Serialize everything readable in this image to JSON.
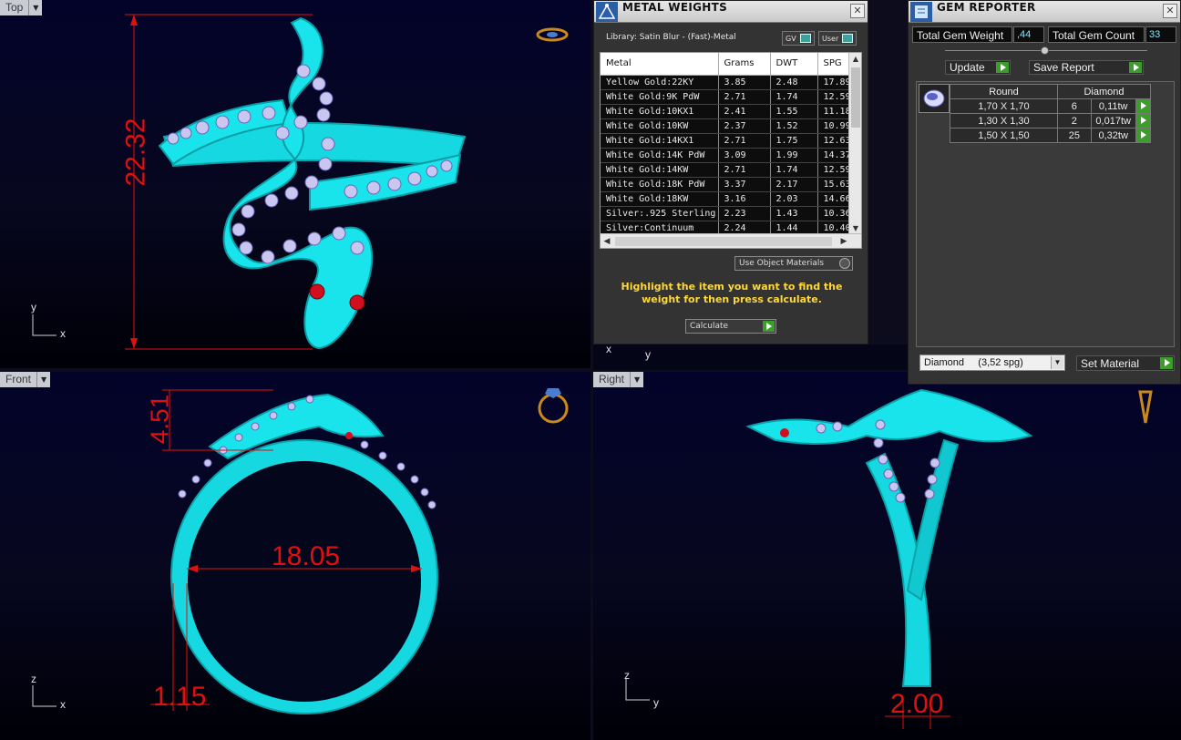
{
  "viewports": {
    "top": {
      "label": "Top",
      "dimension": "22.32",
      "axis_y": "y",
      "axis_x": "x"
    },
    "front": {
      "label": "Front",
      "dimension_height": "4.51",
      "dimension_width": "18.05",
      "dimension_thickness": "1.15",
      "axis_z": "z",
      "axis_x": "x"
    },
    "right": {
      "label": "Right",
      "dimension": "2.00",
      "axis_z": "z",
      "axis_y": "y"
    },
    "perspective_axes": {
      "x": "x",
      "y": "y"
    }
  },
  "metal_weights": {
    "title": "METAL WEIGHTS",
    "library": "Library: Satin Blur - (Fast)-Metal",
    "toggle_gv": "GV",
    "toggle_user": "User",
    "columns": [
      "Metal",
      "Grams",
      "DWT",
      "SPG"
    ],
    "rows": [
      [
        "Yellow Gold:22KY",
        "3.85",
        "2.48",
        "17.89"
      ],
      [
        "White Gold:9K PdW",
        "2.71",
        "1.74",
        "12.59"
      ],
      [
        "White Gold:10KX1",
        "2.41",
        "1.55",
        "11.18"
      ],
      [
        "White Gold:10KW",
        "2.37",
        "1.52",
        "10.99"
      ],
      [
        "White Gold:14KX1",
        "2.71",
        "1.75",
        "12.63"
      ],
      [
        "White Gold:14K PdW",
        "3.09",
        "1.99",
        "14.37"
      ],
      [
        "White Gold:14KW",
        "2.71",
        "1.74",
        "12.59"
      ],
      [
        "White Gold:18K PdW",
        "3.37",
        "2.17",
        "15.63"
      ],
      [
        "White Gold:18KW",
        "3.16",
        "2.03",
        "14.66"
      ],
      [
        "Silver:.925 Sterling",
        "2.23",
        "1.43",
        "10.36"
      ],
      [
        "Silver:Continuum",
        "2.24",
        "1.44",
        "10.40"
      ]
    ],
    "use_object_materials": "Use Object Materials",
    "hint": "Highlight the item you want to find the weight for then press calculate.",
    "calculate": "Calculate"
  },
  "gem_reporter": {
    "title": "GEM REPORTER",
    "total_gem_weight_label": "Total Gem Weight",
    "total_gem_weight_value": ",44",
    "total_gem_count_label": "Total Gem Count",
    "total_gem_count_value": "33",
    "update": "Update",
    "save_report": "Save Report",
    "columns": [
      "Round",
      "Diamond"
    ],
    "rows": [
      [
        "1,70 X 1,70",
        "6",
        "0,11tw"
      ],
      [
        "1,30 X 1,30",
        "2",
        "0,017tw"
      ],
      [
        "1,50 X 1,50",
        "25",
        "0,32tw"
      ]
    ],
    "material_select": "Diamond     (3,52 spg)",
    "set_material": "Set Material"
  },
  "colors": {
    "ring": "#16e0e8",
    "dimension": "#e01010",
    "hint": "#ffd83a",
    "go_button": "#3b9e2a"
  }
}
